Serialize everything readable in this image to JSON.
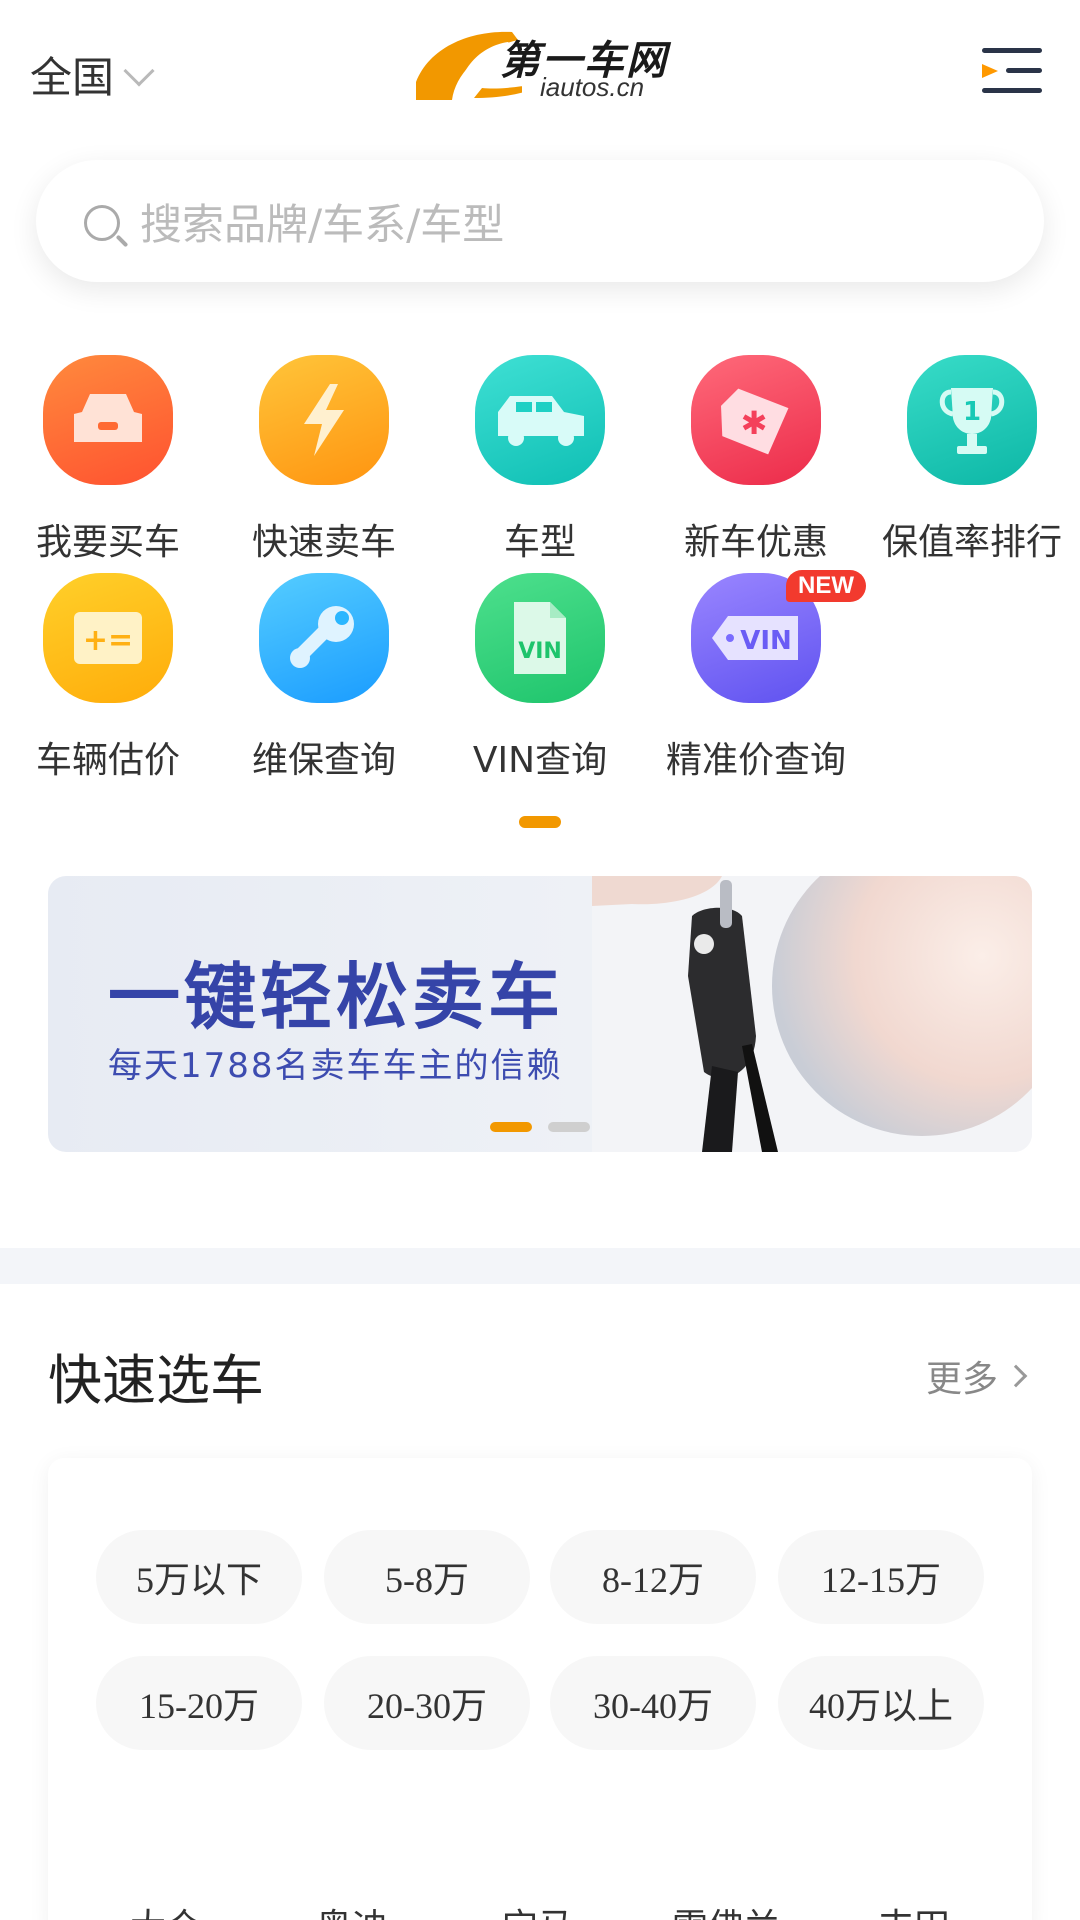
{
  "header": {
    "region_label": "全国",
    "logo_cn": "第一车网",
    "logo_en": "iautos.cn"
  },
  "search": {
    "placeholder": "搜索品牌/车系/车型"
  },
  "quick_entries": [
    {
      "label": "我要买车",
      "icon": "car-front-icon",
      "color": "#ff6a33"
    },
    {
      "label": "快速卖车",
      "icon": "lightning-icon",
      "color": "#ffa214"
    },
    {
      "label": "车型",
      "icon": "suv-icon",
      "color": "#1fd0c4"
    },
    {
      "label": "新车优惠",
      "icon": "discount-tag-icon",
      "color": "#f4405a"
    },
    {
      "label": "保值率排行",
      "icon": "trophy-icon",
      "color": "#17c9b5"
    },
    {
      "label": "车辆估价",
      "icon": "calculator-icon",
      "color": "#ffbf17"
    },
    {
      "label": "维保查询",
      "icon": "wrench-icon",
      "color": "#2ab6ff"
    },
    {
      "label": "VIN查询",
      "icon": "vin-document-icon",
      "color": "#2ed07f"
    },
    {
      "label": "精准价查询",
      "icon": "vin-tag-icon",
      "color": "#7a6cff"
    }
  ],
  "new_badge": "NEW",
  "banner": {
    "title": "一键轻松卖车",
    "subtitle": "每天1788名卖车车主的信赖"
  },
  "quick_select": {
    "title": "快速选车",
    "more_label": "更多",
    "price_ranges": [
      "5万以下",
      "5-8万",
      "8-12万",
      "12-15万",
      "15-20万",
      "20-30万",
      "30-40万",
      "40万以上"
    ],
    "brands": [
      "大众",
      "奥迪",
      "宝马",
      "雪佛兰",
      "丰田"
    ]
  },
  "colors": {
    "accent": "#f29800",
    "banner_text": "#3544a8"
  }
}
